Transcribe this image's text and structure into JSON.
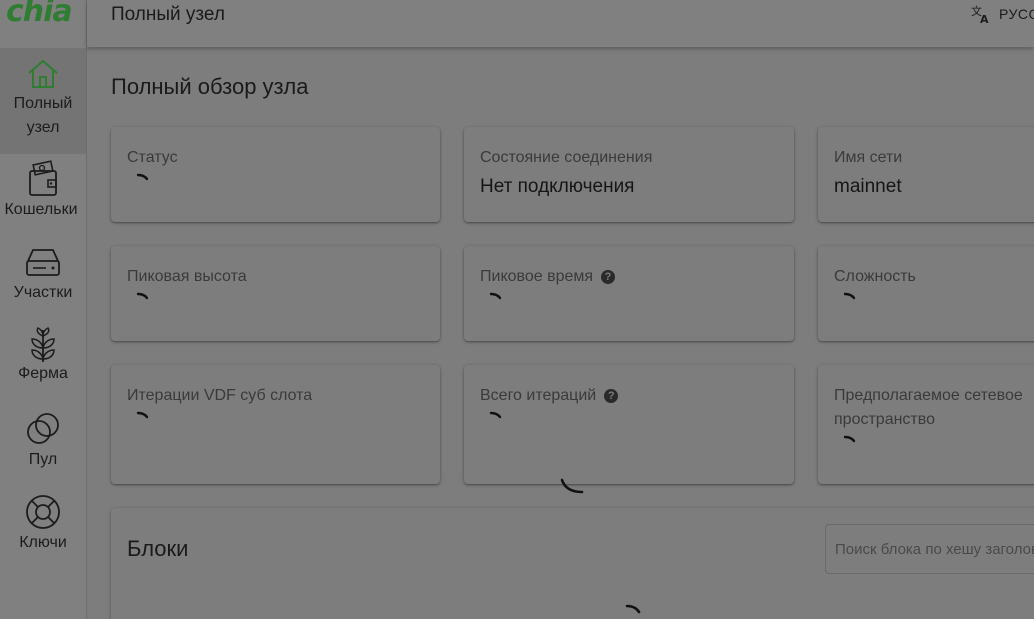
{
  "app": {
    "logo": "chia"
  },
  "sidebar": {
    "items": [
      {
        "label": "Полный узел",
        "icon": "home-icon",
        "active": true
      },
      {
        "label": "Кошельки",
        "icon": "wallet-icon"
      },
      {
        "label": "Участки",
        "icon": "hard-drive-icon"
      },
      {
        "label": "Ферма",
        "icon": "plant-icon"
      },
      {
        "label": "Пул",
        "icon": "pool-circles-icon"
      },
      {
        "label": "Ключи",
        "icon": "lifebuoy-icon"
      }
    ]
  },
  "header": {
    "title": "Полный узел",
    "language": "РУССКИЙ"
  },
  "main": {
    "title": "Полный обзор узла",
    "cards": [
      {
        "label": "Статус",
        "value": ""
      },
      {
        "label": "Состояние соединения",
        "value": "Нет подключения"
      },
      {
        "label": "Имя сети",
        "value": "mainnet"
      },
      {
        "label": "Пиковая высота",
        "value": ""
      },
      {
        "label": "Пиковое время",
        "value": "",
        "help": "?"
      },
      {
        "label": "Сложность",
        "value": ""
      },
      {
        "label": "Итерации VDF суб слота",
        "value": ""
      },
      {
        "label": "Всего итераций",
        "value": "",
        "help": "?"
      },
      {
        "label": "Предполагаемое сетевое пространство",
        "value": ""
      }
    ],
    "blocks": {
      "title": "Блоки",
      "search_placeholder": "Поиск блока по хешу заголовка"
    }
  },
  "colors": {
    "brand": "#2f7d32",
    "overlay": "#7d7d7d"
  }
}
